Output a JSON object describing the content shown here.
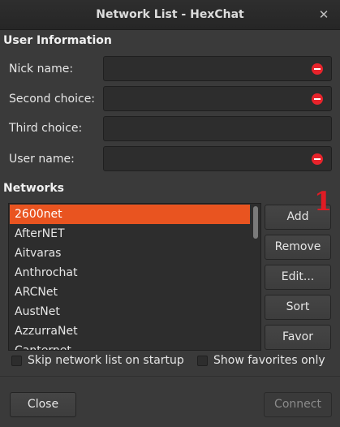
{
  "window": {
    "title": "Network List - HexChat",
    "close_glyph": "✕"
  },
  "user_info": {
    "heading": "User Information",
    "fields": [
      {
        "label": "Nick name:",
        "value": "",
        "error": true
      },
      {
        "label": "Second choice:",
        "value": "",
        "error": true
      },
      {
        "label": "Third choice:",
        "value": "",
        "error": false
      },
      {
        "label": "User name:",
        "value": "",
        "error": true
      }
    ]
  },
  "networks": {
    "heading": "Networks",
    "items": [
      "2600net",
      "AfterNET",
      "Aitvaras",
      "Anthrochat",
      "ARCNet",
      "AustNet",
      "AzzurraNet",
      "Canternet"
    ],
    "selected_index": 0,
    "selected_color": "#e95420"
  },
  "buttons": {
    "add": "Add",
    "remove": "Remove",
    "edit": "Edit...",
    "sort": "Sort",
    "favor": "Favor",
    "close": "Close",
    "connect": "Connect"
  },
  "marker": "1",
  "options": {
    "skip_label": "Skip network list on startup",
    "skip_checked": false,
    "favorites_label": "Show favorites only",
    "favorites_checked": false
  },
  "icons": {
    "error": "dialog-error-icon",
    "close": "close-icon"
  },
  "colors": {
    "accent": "#e95420",
    "error": "#e8232b",
    "marker": "#e01b24"
  }
}
